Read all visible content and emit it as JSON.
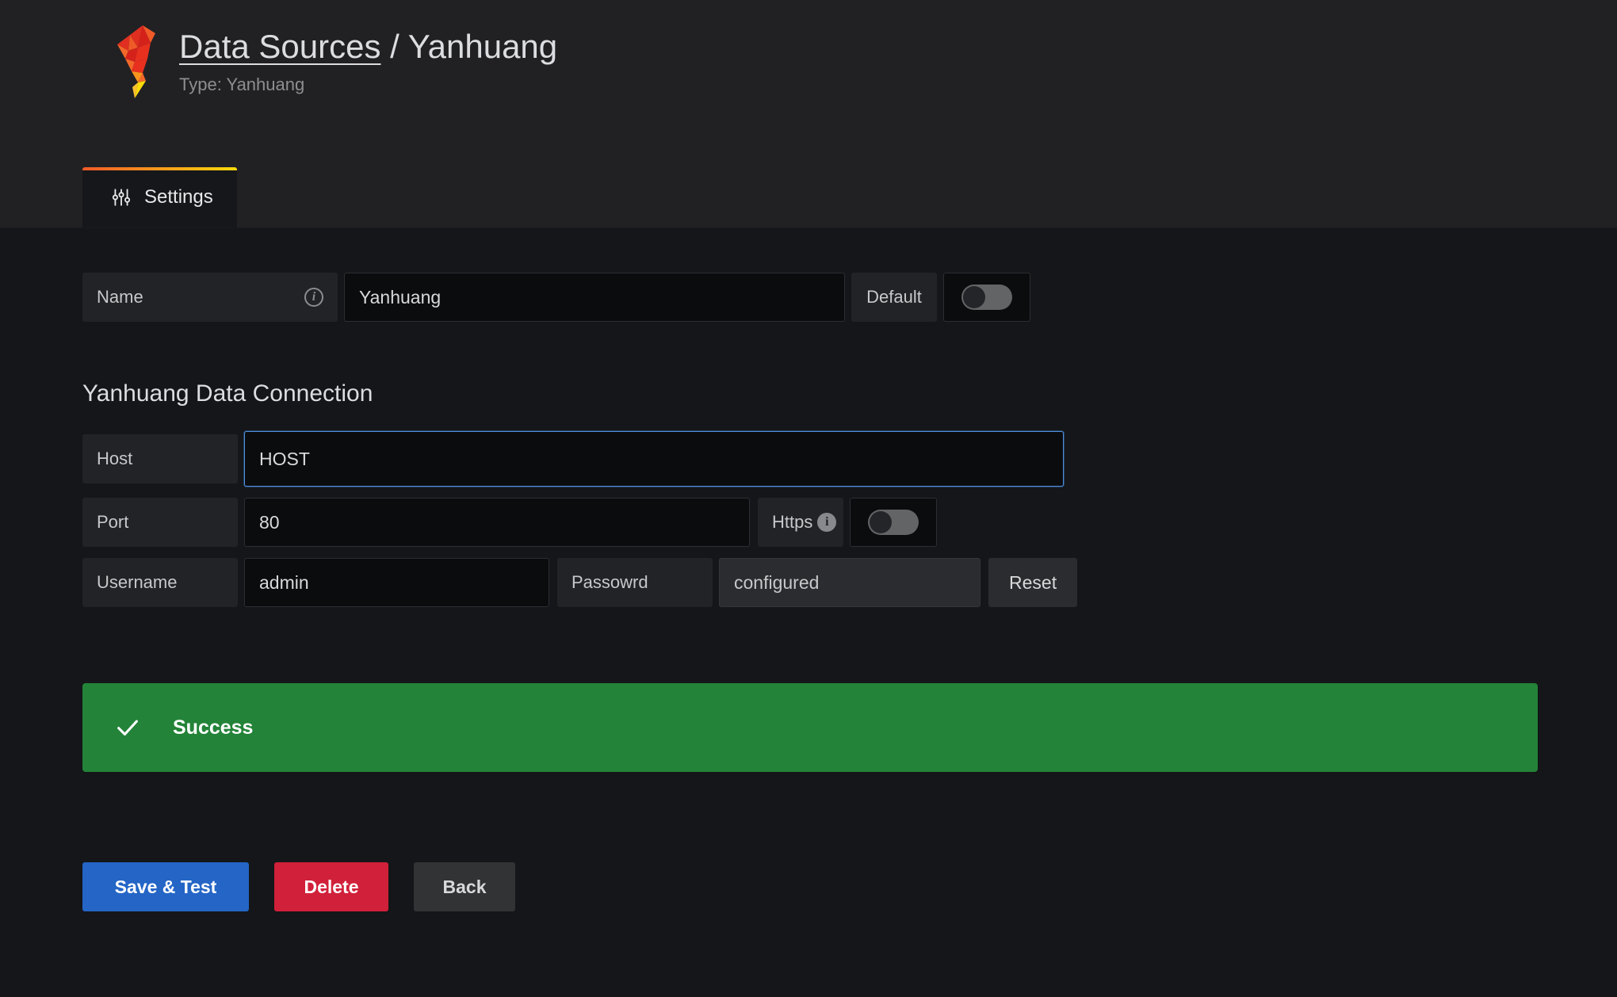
{
  "header": {
    "logo_icon": "grafana-logo-icon",
    "breadcrumb_link": "Data Sources",
    "breadcrumb_separator": "/",
    "breadcrumb_current": "Yanhuang",
    "subtitle": "Type: Yanhuang"
  },
  "tabs": [
    {
      "label": "Settings",
      "icon": "sliders-icon",
      "active": true
    }
  ],
  "settings": {
    "name_field": {
      "label": "Name",
      "info_icon": "info-circle-icon",
      "value": "Yanhuang"
    },
    "default_toggle": {
      "label": "Default",
      "state": "off"
    },
    "section_title": "Yanhuang Data Connection",
    "host_field": {
      "label": "Host",
      "value": "HOST",
      "focused": true
    },
    "port_field": {
      "label": "Port",
      "value": "80"
    },
    "https_toggle": {
      "label": "Https",
      "info_icon": "info-circle-filled-icon",
      "state": "off"
    },
    "username_field": {
      "label": "Username",
      "value": "admin"
    },
    "password_field": {
      "label": "Passowrd",
      "value": "configured",
      "reset_label": "Reset"
    }
  },
  "alert": {
    "icon": "check-icon",
    "message": "Success",
    "color": "#238338"
  },
  "actions": {
    "save_label": "Save & Test",
    "delete_label": "Delete",
    "back_label": "Back",
    "save_color": "#2465c6",
    "delete_color": "#d1203a",
    "back_color": "#323335"
  }
}
